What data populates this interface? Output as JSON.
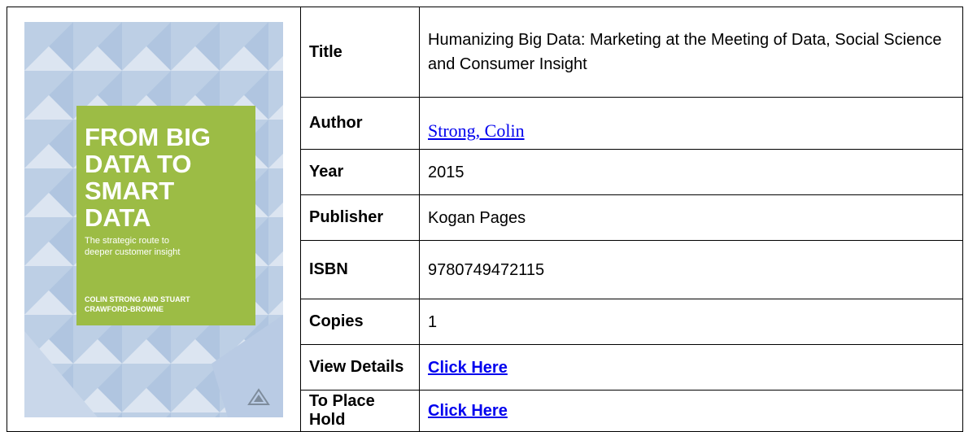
{
  "cover": {
    "headline_lines": [
      "FROM BIG",
      "DATA TO",
      "SMART",
      "DATA"
    ],
    "subtitle_lines": [
      "The strategic route to",
      "deeper customer insight"
    ],
    "author_lines": [
      "COLIN STRONG AND STUART",
      "CRAWFORD-BROWNE"
    ],
    "colors": {
      "background_light": "#dde6f1",
      "background_mid": "#a9c0dd",
      "green_panel": "#9cbc45",
      "publisher_logo": "#7e8c9c"
    },
    "publisher_logo_icon": "kogan-page-logo-icon"
  },
  "rows": [
    {
      "label": "Title",
      "value": "Humanizing Big Data: Marketing at the Meeting of Data, Social Science and Consumer Insight"
    },
    {
      "label": "Author",
      "value": "Strong, Colin"
    },
    {
      "label": "Year",
      "value": "2015"
    },
    {
      "label": "Publisher",
      "value": "Kogan Pages"
    },
    {
      "label": "ISBN",
      "value": "9780749472115"
    },
    {
      "label": "Copies",
      "value": "1"
    },
    {
      "label": "View Details",
      "value": "Click Here"
    },
    {
      "label": "To Place Hold",
      "value": "Click Here"
    }
  ],
  "colors": {
    "link": "#0000ee",
    "border": "#000000"
  }
}
